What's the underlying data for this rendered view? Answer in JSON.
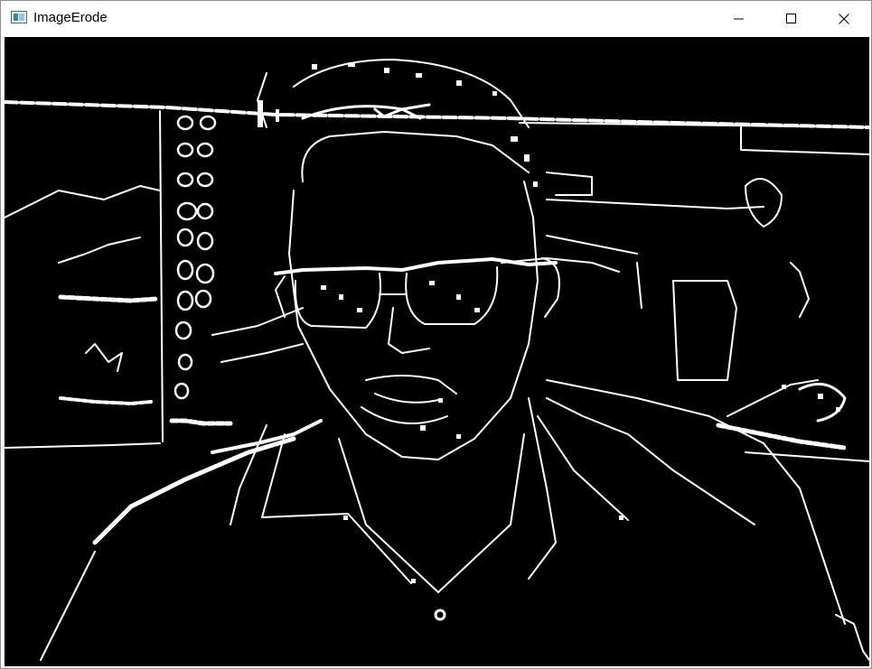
{
  "window": {
    "title": "ImageErode"
  },
  "icons": {
    "app": "app-window-icon",
    "minimize": "minimize-icon",
    "maximize": "maximize-icon",
    "close": "close-icon"
  },
  "canvas": {
    "background": "#000000",
    "edge_color": "#ffffff"
  }
}
